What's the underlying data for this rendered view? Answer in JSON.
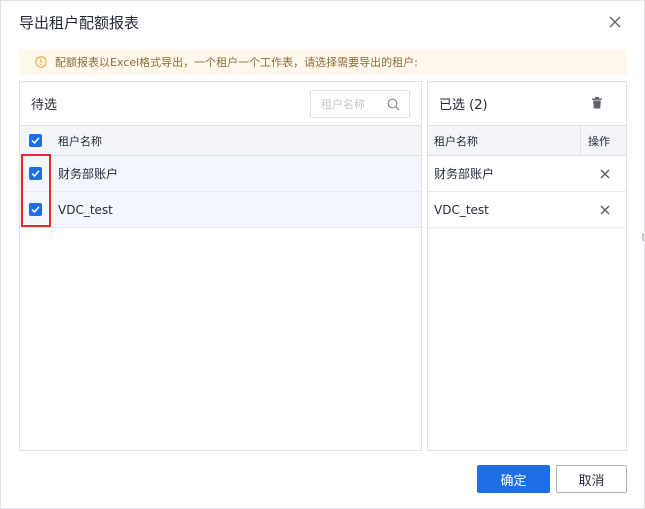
{
  "dialog": {
    "title": "导出租户配额报表",
    "notice": "配额报表以Excel格式导出，一个租户一个工作表，请选择需要导出的租户:"
  },
  "left_panel": {
    "title": "待选",
    "search_placeholder": "租户名称",
    "column_name": "租户名称",
    "rows": [
      {
        "name": "财务部账户",
        "checked": true
      },
      {
        "name": "VDC_test",
        "checked": true
      }
    ]
  },
  "right_panel": {
    "title": "已选 (2)",
    "column_name": "租户名称",
    "column_op": "操作",
    "rows": [
      {
        "name": "财务部账户"
      },
      {
        "name": "VDC_test"
      }
    ]
  },
  "footer": {
    "confirm_label": "确定",
    "cancel_label": "取消"
  },
  "colors": {
    "primary": "#1e6ee6",
    "highlight": "#e32b2b",
    "notice_bg": "#fff9ed",
    "notice_icon": "#e8a23b"
  },
  "icons": {
    "close": "close-icon",
    "info": "info-icon",
    "search": "search-icon",
    "trash": "trash-icon",
    "check": "check-icon",
    "remove": "remove-icon"
  }
}
